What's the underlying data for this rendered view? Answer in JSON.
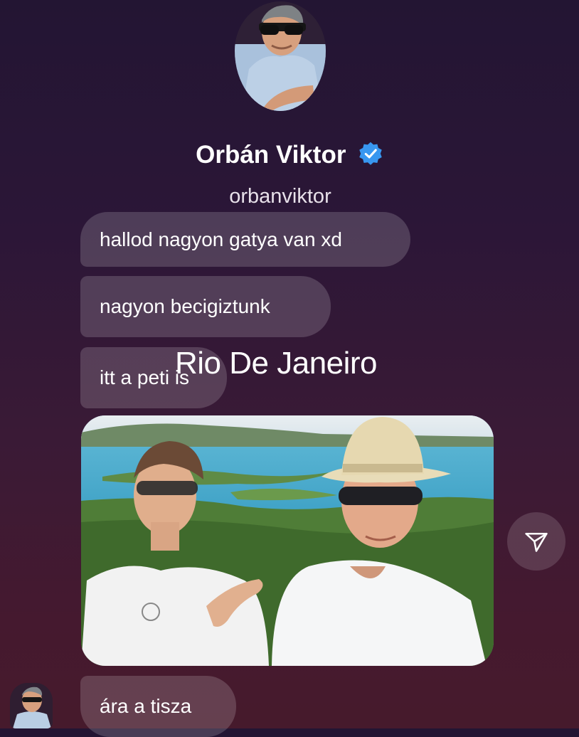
{
  "profile": {
    "name": "Orbán Viktor",
    "handle": "orbanviktor",
    "verified": true
  },
  "messages": [
    {
      "text": "hallod nagyon gatya van xd"
    },
    {
      "text": "nagyon becigiztunk"
    },
    {
      "text": "itt a peti is"
    },
    {
      "text": "ára a tisza"
    }
  ],
  "overlay_caption": "Rio De Janeiro",
  "icons": {
    "verified": "verified-badge-icon",
    "share": "paper-plane-icon"
  },
  "colors": {
    "background_top": "#231533",
    "background_bottom": "#461a2c",
    "verified_blue": "#3897f0",
    "bubble": "rgba(255,255,255,0.17)"
  }
}
